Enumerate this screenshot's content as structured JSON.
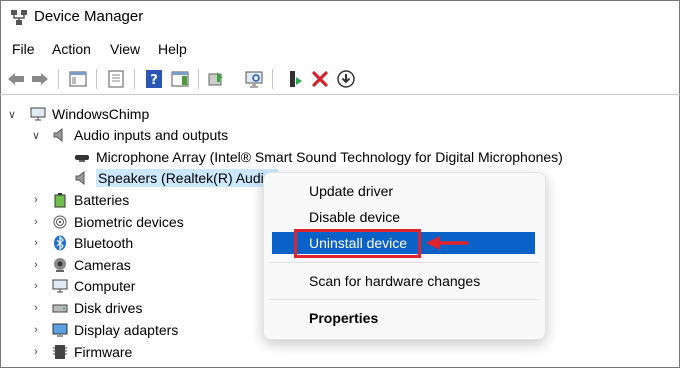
{
  "window": {
    "title": "Device Manager",
    "title_icon": "device-manager-icon"
  },
  "menu": [
    "File",
    "Action",
    "View",
    "Help"
  ],
  "toolbar": [
    "back-arrow-icon",
    "forward-arrow-icon",
    "properties-icon",
    "show-hidden-icon",
    "help-icon",
    "action-pane-icon",
    "update-driver-icon",
    "scan-hardware-icon",
    "add-driver-icon",
    "uninstall-x-icon",
    "download-icon"
  ],
  "tree": {
    "root": "WindowsChimp",
    "audio_category": "Audio inputs and outputs",
    "audio_children": [
      "Microphone Array (Intel® Smart Sound Technology for Digital Microphones)",
      "Speakers (Realtek(R) Audio)"
    ],
    "categories": [
      "Batteries",
      "Biometric devices",
      "Bluetooth",
      "Cameras",
      "Computer",
      "Disk drives",
      "Display adapters",
      "Firmware"
    ]
  },
  "context_menu": {
    "items": [
      "Update driver",
      "Disable device",
      "Uninstall device",
      "Scan for hardware changes",
      "Properties"
    ],
    "highlighted": "Uninstall device"
  },
  "colors": {
    "highlight": "#0a62c9",
    "annotation_red": "#e0242c",
    "selection": "#cce8ff"
  }
}
